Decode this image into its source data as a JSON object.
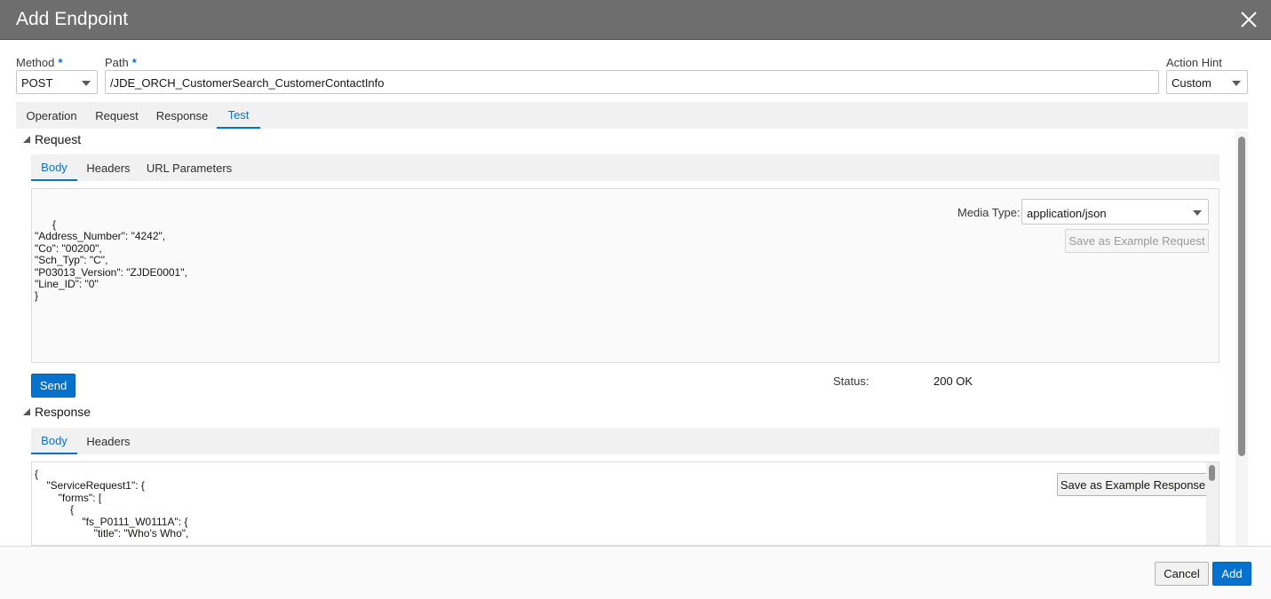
{
  "dialog": {
    "title": "Add Endpoint"
  },
  "form": {
    "method": {
      "label": "Method",
      "required_mark": "*",
      "value": "POST"
    },
    "path": {
      "label": "Path",
      "required_mark": "*",
      "value": "/JDE_ORCH_CustomerSearch_CustomerContactInfo"
    },
    "action_hint": {
      "label": "Action Hint",
      "value": "Custom"
    }
  },
  "main_tabs": [
    {
      "label": "Operation",
      "active": false
    },
    {
      "label": "Request",
      "active": false
    },
    {
      "label": "Response",
      "active": false
    },
    {
      "label": "Test",
      "active": true
    }
  ],
  "request": {
    "heading": "Request",
    "tabs": [
      {
        "label": "Body",
        "active": true
      },
      {
        "label": "Headers",
        "active": false
      },
      {
        "label": "URL Parameters",
        "active": false
      }
    ],
    "body_text": "      {\n\"Address_Number\": \"4242\",\n\"Co\": \"00200\",\n\"Sch_Typ\": \"C\",\n\"P03013_Version\": \"ZJDE0001\",\n\"Line_ID\": \"0\"\n}",
    "media_type_label": "Media Type:",
    "media_type_value": "application/json",
    "save_example_label": "Save as Example Request",
    "send_label": "Send",
    "status_label": "Status:",
    "status_value": "200 OK"
  },
  "response": {
    "heading": "Response",
    "tabs": [
      {
        "label": "Body",
        "active": true
      },
      {
        "label": "Headers",
        "active": false
      }
    ],
    "body_text": "{\n    \"ServiceRequest1\": {\n        \"forms\": [\n            {\n                \"fs_P0111_W0111A\": {\n                    \"title\": \"Who's Who\",",
    "save_example_label": "Save as Example Response"
  },
  "footer": {
    "cancel_label": "Cancel",
    "add_label": "Add"
  },
  "colors": {
    "accent": "#0572ce",
    "titlebar": "#6e6e6e"
  }
}
